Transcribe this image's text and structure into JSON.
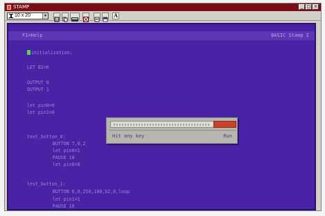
{
  "window": {
    "title": "STAMP"
  },
  "toolbar": {
    "font_value": "10 x 20",
    "font_arrow": "▼",
    "buttons": [
      {
        "name": "window-icon"
      },
      {
        "name": "copy-icon"
      },
      {
        "name": "paste-icon"
      },
      {
        "name": "fullscreen-icon"
      },
      {
        "name": "properties-icon"
      },
      {
        "name": "background-icon"
      },
      {
        "name": "font-icon",
        "label": "A"
      }
    ]
  },
  "menu": {
    "help": "F1=Help",
    "app_title": "BASIC Stamp I"
  },
  "code": {
    "lines": [
      "initialization:",
      "LET B2=0",
      "OUTPUT 0",
      "OUTPUT 1",
      "let pin0=0",
      "let pin1=0",
      "test_button_0:",
      "     BUTTON 7,0,2",
      "     let pin0=1",
      "     PAUSE 10",
      "     let pin0=0",
      "test_button_1:",
      "     BUTTON 6,0,250,100,b2,0,loop",
      "     let pin1=1",
      "     PAUSE 10"
    ]
  },
  "dialog": {
    "message": "Hit any key",
    "status": "Run"
  },
  "colors": {
    "screen_bg": "#4a22a6",
    "code_text": "#9b87d4",
    "cursor": "#58d05a",
    "progress": "#c8432a",
    "titlebar": "#7a0d16"
  }
}
